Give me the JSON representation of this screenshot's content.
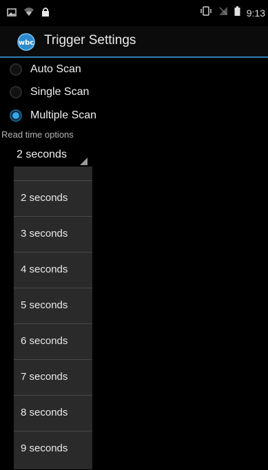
{
  "status_bar": {
    "time": "9:13",
    "icons": [
      "image-icon",
      "wifi-icon",
      "lock-icon",
      "vibrate-icon",
      "no-signal-icon",
      "battery-icon"
    ]
  },
  "app_bar": {
    "title": "Trigger Settings",
    "logo_icon": "wbc-logo-icon",
    "logo_text": "wbc"
  },
  "scan_modes": [
    {
      "label": "Auto Scan",
      "checked": false
    },
    {
      "label": "Single Scan",
      "checked": false
    },
    {
      "label": "Multiple Scan",
      "checked": true
    }
  ],
  "read_time": {
    "label": "Read time options",
    "selected": "2 seconds",
    "options": [
      "2 seconds",
      "3 seconds",
      "4 seconds",
      "5 seconds",
      "6 seconds",
      "7 seconds",
      "8 seconds",
      "9 seconds"
    ]
  },
  "colors": {
    "accent": "#39a7e6",
    "divider": "#2f7fb0",
    "dropdown_bg": "#2a2a2a"
  }
}
